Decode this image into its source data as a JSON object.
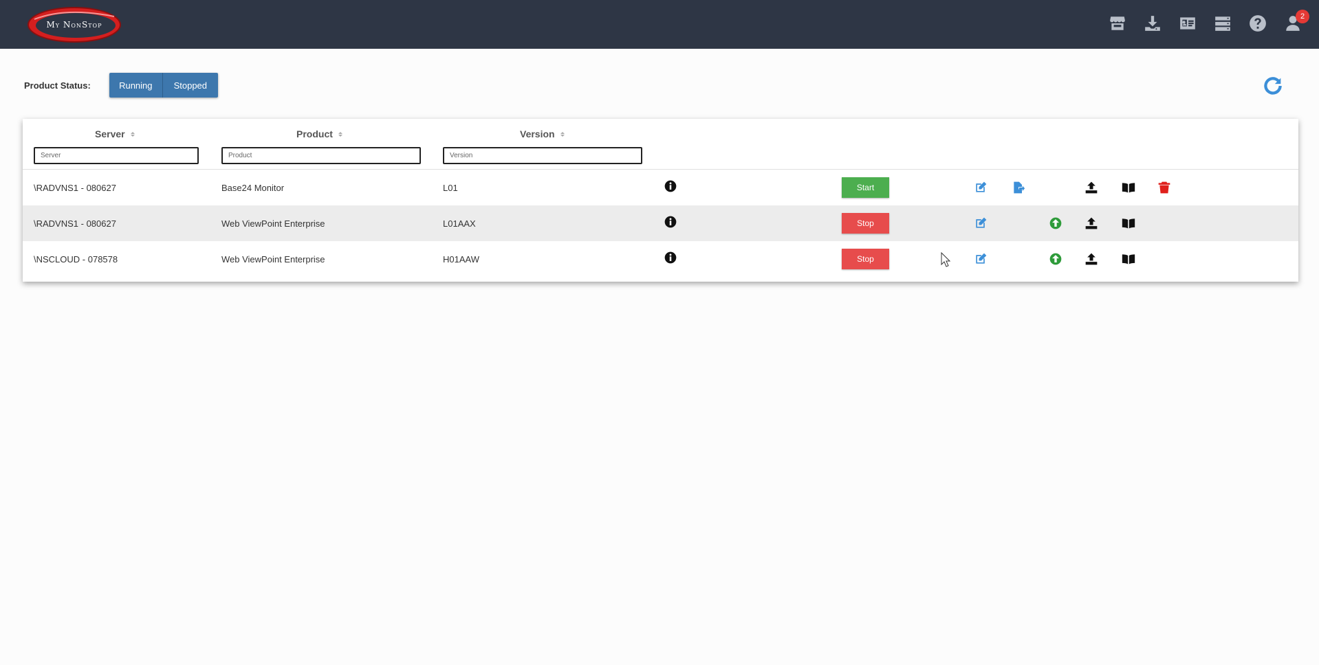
{
  "app": {
    "logo_text": "My NonStop"
  },
  "topbar": {
    "icons": [
      "store-icon",
      "download-icon",
      "id-card-icon",
      "server-icon",
      "help-icon",
      "user-icon"
    ],
    "notification_count": "2"
  },
  "filters": {
    "status_label": "Product Status:",
    "running_label": "Running",
    "stopped_label": "Stopped"
  },
  "table": {
    "headers": {
      "server": "Server",
      "product": "Product",
      "version": "Version"
    },
    "placeholders": {
      "server": "Server",
      "product": "Product",
      "version": "Version"
    },
    "rows": [
      {
        "server": "\\RADVNS1 - 080627",
        "product": "Base24 Monitor",
        "version": "L01",
        "action": "Start"
      },
      {
        "server": "\\RADVNS1 - 080627",
        "product": "Web ViewPoint Enterprise",
        "version": "L01AAX",
        "action": "Stop"
      },
      {
        "server": "\\NSCLOUD - 078578",
        "product": "Web ViewPoint Enterprise",
        "version": "H01AAW",
        "action": "Stop"
      }
    ]
  },
  "colors": {
    "topbar": "#2e3645",
    "segment_blue": "#3d77ad",
    "start_green": "#4cae4f",
    "stop_red": "#e74c4c",
    "edit_blue": "#3c8fd8",
    "upgrade_green": "#2e9b3a",
    "delete_red": "#e0201c"
  }
}
